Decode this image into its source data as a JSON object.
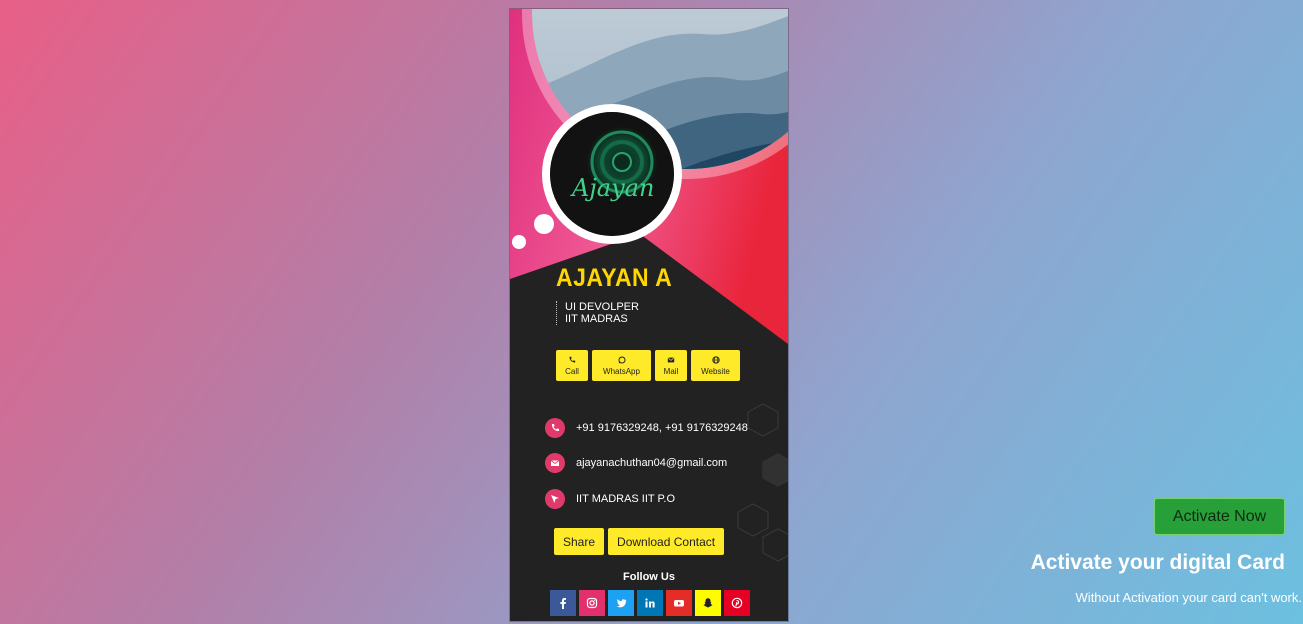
{
  "card": {
    "name": "AJAYAN A",
    "role_line1": "UI DEVOLPER",
    "role_line2": "IIT MADRAS",
    "logo_text": "Ajayan",
    "actions": [
      {
        "label": "Call",
        "icon": "phone-icon"
      },
      {
        "label": "WhatsApp",
        "icon": "whatsapp-icon"
      },
      {
        "label": "Mail",
        "icon": "mail-icon"
      },
      {
        "label": "Website",
        "icon": "globe-icon"
      }
    ],
    "contacts": [
      {
        "text": "+91 9176329248, +91 9176329248",
        "icon": "phone-icon"
      },
      {
        "text": "ajayanachuthan04@gmail.com",
        "icon": "mail-icon"
      },
      {
        "text": "IIT MADRAS IIT P.O",
        "icon": "location-icon"
      }
    ],
    "share_label": "Share",
    "download_label": "Download Contact",
    "follow_label": "Follow Us",
    "social": [
      {
        "name": "facebook-icon",
        "color": "#3b5998"
      },
      {
        "name": "instagram-icon",
        "color": "#e1306c"
      },
      {
        "name": "twitter-icon",
        "color": "#1da1f2"
      },
      {
        "name": "linkedin-icon",
        "color": "#0077b5"
      },
      {
        "name": "youtube-icon",
        "color": "#e52d27"
      },
      {
        "name": "snapchat-icon",
        "color": "#fffc00"
      },
      {
        "name": "pinterest-icon",
        "color": "#e60023"
      }
    ],
    "accent_color": "#ffea2a",
    "name_color": "#ffd600",
    "pink": "#e03a6b"
  },
  "activation": {
    "button_label": "Activate Now",
    "title": "Activate your digital Card",
    "subtitle": "Without Activation your card can't work."
  }
}
